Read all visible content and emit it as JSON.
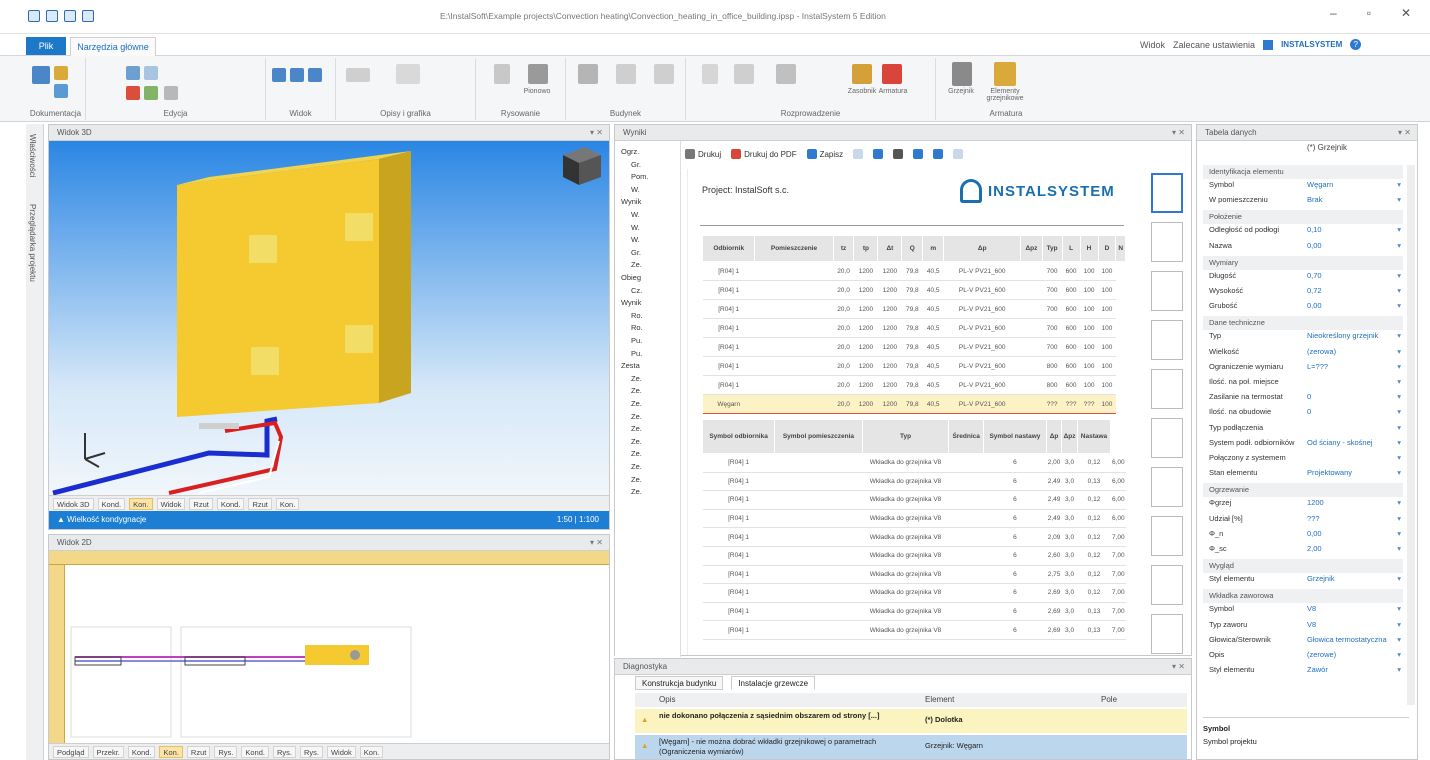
{
  "window": {
    "title": "E:\\InstalSoft\\Example projects\\Convection heating\\Convection_heating_in_office_building.ipsp - InstalSystem 5 Edition",
    "controls": [
      "–",
      "▫",
      "✕"
    ]
  },
  "ribbon": {
    "tabs": [
      "Plik",
      "Narzędzia główne"
    ],
    "right_items": [
      "Widok",
      "Zalecane ustawienia"
    ],
    "brand": "INSTALSYSTEM",
    "groups": [
      "Dokumentacja",
      "Edycja",
      "Widok",
      "Opisy i grafika",
      "Rysowanie",
      "Budynek",
      "Rozprowadzenie",
      "Armatura"
    ],
    "buttons": [
      "Pionowo",
      "Zasobnik",
      "Grzejnik",
      "Armatura",
      "Elementy grzejnikowe"
    ]
  },
  "left_strip": {
    "labels": [
      "Właściwości",
      "Przeglądarka projektu"
    ]
  },
  "view3d": {
    "header": "Widok 3D",
    "tabs": [
      "Widok 3D",
      "Kond.",
      "Kon.",
      "Widok",
      "Rzut",
      "Kond.",
      "Rzut",
      "Kon."
    ],
    "active_tab_index": 2,
    "status_left": "Wielkość kondygnacje",
    "status_right": "1:50  |  1:100"
  },
  "view2d": {
    "header": "Widok 2D",
    "tabs": [
      "Podgląd",
      "Przekr.",
      "Kond.",
      "Kon.",
      "Rzut",
      "Rys.",
      "Kond.",
      "Rys.",
      "Rys.",
      "Widok",
      "Kon."
    ],
    "active_tab_index": 3
  },
  "results": {
    "header": "Wyniki",
    "toolbar": [
      "Drukuj",
      "Drukuj do PDF",
      "Zapisz"
    ],
    "project_title": "Project: InstalSoft s.c.",
    "logo_text": "INSTALSYSTEM",
    "tree": [
      "Ogrz.",
      "Gr.",
      "Pom.",
      "W.",
      "Wynik",
      "W.",
      "W.",
      "W.",
      "Gr.",
      "Ze.",
      "Obieg",
      "Cz.",
      "Wynik",
      "Ro.",
      "Ro.",
      "Pu.",
      "Pu.",
      "Zesta",
      "Ze.",
      "Ze.",
      "Ze.",
      "Ze.",
      "Ze.",
      "Ze.",
      "Ze.",
      "Ze.",
      "Ze.",
      "Ze."
    ],
    "table1": {
      "headers": [
        "Odbiornik",
        "Pomieszczenie",
        "tz",
        "tp",
        "Δt",
        "Q",
        "m",
        "Δp",
        "Δpz",
        "Typ",
        "L",
        "H",
        "D",
        "N"
      ],
      "rows": [
        [
          "[R04] 1",
          "",
          "20,0",
          "1200",
          "1200",
          "79,8",
          "40,5",
          "PL-V PV21_600",
          "",
          "700",
          "600",
          "100",
          "100"
        ],
        [
          "[R04] 1",
          "",
          "20,0",
          "1200",
          "1200",
          "79,8",
          "40,5",
          "PL-V PV21_600",
          "",
          "700",
          "600",
          "100",
          "100"
        ],
        [
          "[R04] 1",
          "",
          "20,0",
          "1200",
          "1200",
          "79,8",
          "40,5",
          "PL-V PV21_600",
          "",
          "700",
          "600",
          "100",
          "100"
        ],
        [
          "[R04] 1",
          "",
          "20,0",
          "1200",
          "1200",
          "79,8",
          "40,5",
          "PL-V PV21_600",
          "",
          "700",
          "600",
          "100",
          "100"
        ],
        [
          "[R04] 1",
          "",
          "20,0",
          "1200",
          "1200",
          "79,8",
          "40,5",
          "PL-V PV21_600",
          "",
          "700",
          "600",
          "100",
          "100"
        ],
        [
          "[R04] 1",
          "",
          "20,0",
          "1200",
          "1200",
          "79,8",
          "40,5",
          "PL-V PV21_600",
          "",
          "800",
          "600",
          "100",
          "100"
        ],
        [
          "[R04] 1",
          "",
          "20,0",
          "1200",
          "1200",
          "79,8",
          "40,5",
          "PL-V PV21_600",
          "",
          "800",
          "600",
          "100",
          "100"
        ],
        [
          "Węgarn",
          "",
          "20,0",
          "1200",
          "1200",
          "79,8",
          "40,5",
          "PL-V PV21_600",
          "",
          "???",
          "???",
          "???",
          "100"
        ]
      ],
      "highlight_row": 7
    },
    "table2": {
      "headers": [
        "Symbol odbiornika",
        "Symbol pomieszczenia",
        "Typ",
        "Średnica",
        "Symbol nastawy",
        "Δp",
        "Δpz",
        "Nastawa"
      ],
      "rows": [
        [
          "[R04] 1",
          "",
          "Wkładka do grzejnika V8",
          "",
          "6",
          "2,00",
          "3,0",
          "0,12",
          "6,00"
        ],
        [
          "[R04] 1",
          "",
          "Wkładka do grzejnika V8",
          "",
          "6",
          "2,49",
          "3,0",
          "0,13",
          "6,00"
        ],
        [
          "[R04] 1",
          "",
          "Wkładka do grzejnika V8",
          "",
          "6",
          "2,49",
          "3,0",
          "0,12",
          "6,00"
        ],
        [
          "[R04] 1",
          "",
          "Wkładka do grzejnika V8",
          "",
          "6",
          "2,49",
          "3,0",
          "0,12",
          "6,00"
        ],
        [
          "[R04] 1",
          "",
          "Wkładka do grzejnika V8",
          "",
          "6",
          "2,09",
          "3,0",
          "0,12",
          "7,00"
        ],
        [
          "[R04] 1",
          "",
          "Wkładka do grzejnika V8",
          "",
          "6",
          "2,60",
          "3,0",
          "0,12",
          "7,00"
        ],
        [
          "[R04] 1",
          "",
          "Wkładka do grzejnika V8",
          "",
          "6",
          "2,75",
          "3,0",
          "0,12",
          "7,00"
        ],
        [
          "[R04] 1",
          "",
          "Wkładka do grzejnika V8",
          "",
          "6",
          "2,69",
          "3,0",
          "0,12",
          "7,00"
        ],
        [
          "[R04] 1",
          "",
          "Wkładka do grzejnika V8",
          "",
          "6",
          "2,69",
          "3,0",
          "0,13",
          "7,00"
        ],
        [
          "[R04] 1",
          "",
          "Wkładka do grzejnika V8",
          "",
          "6",
          "2,69",
          "3,0",
          "0,13",
          "7,00"
        ]
      ]
    }
  },
  "diagnostics": {
    "header": "Diagnostyka",
    "tabs": [
      "Konstrukcja budynku",
      "Instalacje grzewcze"
    ],
    "columns": [
      "Opis",
      "Element",
      "Pole"
    ],
    "rows": [
      {
        "text": "nie dokonano połączenia z sąsiednim obszarem od strony [...]",
        "element": "(*) Dolotka"
      },
      {
        "text": "[Węgarn] - nie można dobrać wkładki grzejnikowej o parametrach (Ograniczenia wymiarów)",
        "element": "Grzejnik: Węgarn"
      }
    ]
  },
  "properties": {
    "header": "Tabela danych",
    "search": "(*) Grzejnik",
    "categories": [
      {
        "name": "Identyfikacja elementu",
        "rows": [
          [
            "Symbol",
            "Węgarn"
          ],
          [
            "W pomieszczeniu",
            "Brak"
          ]
        ]
      },
      {
        "name": "Położenie",
        "rows": [
          [
            "Odległość od podłogi",
            "0,10"
          ],
          [
            "Nazwa",
            "0,00"
          ]
        ]
      },
      {
        "name": "Wymiary",
        "rows": [
          [
            "Długość",
            "0,70"
          ],
          [
            "Wysokość",
            "0,72"
          ],
          [
            "Grubość",
            "0,00"
          ]
        ]
      },
      {
        "name": "Dane techniczne",
        "rows": [
          [
            "Typ",
            "Nieokreślony grzejnik"
          ],
          [
            "Wielkość",
            "(zerowa)"
          ],
          [
            "Ograniczenie wymiaru",
            "L=???"
          ],
          [
            "Ilość. na poł. miejsce",
            ""
          ],
          [
            "Zasilanie na termostat",
            "0"
          ],
          [
            "Ilość. na obudowie",
            "0"
          ],
          [
            "Typ podłączenia",
            ""
          ],
          [
            "System podł. odbiorników",
            "Od ściany - skośnej"
          ],
          [
            "Połączony z systemem",
            ""
          ],
          [
            "Stan elementu",
            "Projektowany"
          ]
        ]
      },
      {
        "name": "Ogrzewanie",
        "rows": [
          [
            "Φgrzej",
            "1200"
          ],
          [
            "Udział [%]",
            "???"
          ],
          [
            "Φ_n",
            "0,00"
          ],
          [
            "Φ_sc",
            "2,00"
          ]
        ]
      },
      {
        "name": "Wygląd",
        "rows": [
          [
            "Styl elementu",
            "Grzejnik"
          ]
        ]
      },
      {
        "name": "Wkładka zaworowa",
        "rows": [
          [
            "Symbol",
            "V8"
          ],
          [
            "Typ zaworu",
            "V8"
          ],
          [
            "Głowica/Sterownik",
            "Głowica termostatyczna"
          ],
          [
            "Opis",
            "(zerowe)"
          ],
          [
            "Styl elementu",
            "Zawór"
          ]
        ]
      }
    ],
    "desc_title": "Symbol",
    "desc_text": "Symbol projektu"
  }
}
